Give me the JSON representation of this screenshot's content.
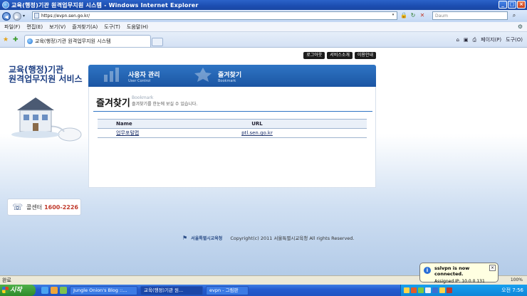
{
  "browser": {
    "window_title": "교육(행정)기관 원격업무지원 시스템 - Windows Internet Explorer",
    "url": "https://evpn.sen.go.kr/",
    "search_placeholder": "Daum",
    "menu": [
      "파일(F)",
      "편집(E)",
      "보기(V)",
      "즐겨찾기(A)",
      "도구(T)",
      "도움말(H)"
    ],
    "tab_title": "교육(행정)기관 원격업무지원 시스템",
    "cmd_page": "페이지(P)",
    "cmd_tools": "도구(O)",
    "status_text": "완료",
    "zoom": "100%"
  },
  "site": {
    "title_line1": "교육(행정)기관",
    "title_line2": "원격업무지원 서비스",
    "top_links": [
      "로그아웃",
      "서비스소개",
      "이용안내"
    ],
    "nav": [
      {
        "name": "사용자 관리",
        "en": "User Control"
      },
      {
        "name": "즐겨찾기",
        "en": "Bookmark"
      }
    ],
    "callcenter_label": "콜센터",
    "callcenter_number": "1600-2226"
  },
  "bookmark": {
    "title": "즐겨찾기",
    "subtitle_en": "Bookmark",
    "description": "즐겨찾기를 한눈에 보실 수 있습니다.",
    "columns": [
      "Name",
      "URL"
    ],
    "rows": [
      {
        "name": "업무포털맵",
        "url": "ptl.sen.go.kr"
      }
    ]
  },
  "footer": {
    "org": "서울특별시교육청",
    "copyright": "Copyright(c) 2011 서울특별시교육청 All rights Reserved."
  },
  "taskbar": {
    "start": "시작",
    "buttons": [
      "Jungle Onion's Blog ::...",
      "교육(행정)기관 원...",
      "evpn - 그림판"
    ],
    "clock": "오전 7:56"
  },
  "balloon": {
    "title": "sslvpn is now connected.",
    "text": "Assigned IP: 10.0.0.131"
  },
  "colors": {
    "brand_blue": "#1b55a3",
    "callcenter_red": "#c0392b"
  }
}
